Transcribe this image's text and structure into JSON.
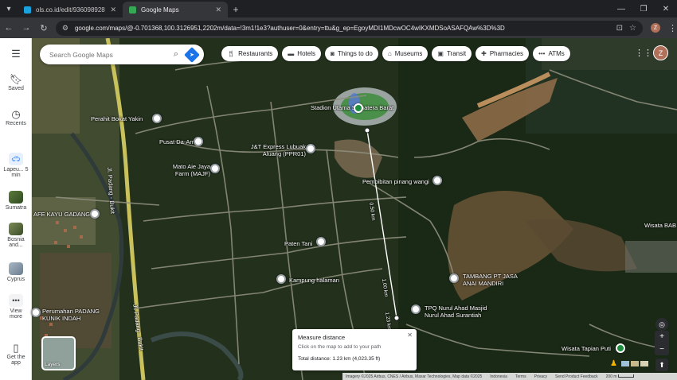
{
  "browser": {
    "tabs": [
      {
        "title": "ols.co.id/edit/936098928",
        "active": false,
        "favicon_color": "#18a3e0"
      },
      {
        "title": "Google Maps",
        "active": true,
        "favicon_color": "#34a853"
      }
    ],
    "url": "google.com/maps/@-0.701368,100.3126951,2202m/data=!3m1!1e3?authuser=0&entry=ttu&g_ep=EgoyMDI1MDcwOC4wIKXMDSoASAFQAw%3D%3D",
    "profile_initial": "Z"
  },
  "sidebar": {
    "items": [
      {
        "label": "Saved",
        "icon": "bookmark-icon"
      },
      {
        "label": "Recents",
        "icon": "history-icon"
      },
      {
        "label": "Lapeu... 5 min",
        "icon": "car-icon"
      },
      {
        "label": "Sumatra",
        "icon": "place-thumbnail"
      },
      {
        "label": "Bosnia and...",
        "icon": "place-thumbnail"
      },
      {
        "label": "Cyprus",
        "icon": "place-thumbnail"
      },
      {
        "label": "View more",
        "icon": "more-icon"
      },
      {
        "label": "Get the app",
        "icon": "phone-icon"
      }
    ]
  },
  "search": {
    "placeholder": "Search Google Maps"
  },
  "chips": [
    {
      "label": "Restaurants",
      "icon": "fork-knife-icon"
    },
    {
      "label": "Hotels",
      "icon": "bed-icon"
    },
    {
      "label": "Things to do",
      "icon": "camera-icon"
    },
    {
      "label": "Museums",
      "icon": "museum-icon"
    },
    {
      "label": "Transit",
      "icon": "bus-icon"
    },
    {
      "label": "Pharmacies",
      "icon": "pharmacy-icon"
    },
    {
      "label": "ATMs",
      "icon": "atm-icon"
    }
  ],
  "account_initial": "Z",
  "places": [
    {
      "name": "Stadion Utama Sumatera Barat",
      "kind": "green"
    },
    {
      "name": "Perahit Bokat Yakin",
      "kind": "white"
    },
    {
      "name": "Pusat Da-Am",
      "kind": "white"
    },
    {
      "name": "J&T Express Lubuak Aluang (PPR01)",
      "kind": "white"
    },
    {
      "name": "Mato Aie Jaya Farm (MAJF)",
      "kind": "white"
    },
    {
      "name": "Pembibitan pinang wangi",
      "kind": "white"
    },
    {
      "name": "AFE KAYU GADANG",
      "kind": "white"
    },
    {
      "name": "Paten Tani",
      "kind": "white"
    },
    {
      "name": "Kampung halaman",
      "kind": "white"
    },
    {
      "name": "TAMBANG PT JASA ANAI MANDIRI",
      "kind": "white"
    },
    {
      "name": "TPQ Nurul Ahad Masjid Nurul Ahad Surantiah",
      "kind": "white"
    },
    {
      "name": "Perumahan PADANG KUNIK INDAH",
      "kind": "white"
    },
    {
      "name": "Wisata Tapian Puti",
      "kind": "green"
    },
    {
      "name": "Wisata BAB",
      "kind": "none"
    }
  ],
  "road_labels": [
    "Jl. Padang - Bukit",
    "Jl. Padang - Bukit"
  ],
  "measure_labels": [
    "0.50 km",
    "1.00 km",
    "1.23 km"
  ],
  "measure": {
    "title": "Measure distance",
    "hint": "Click on the map to add to your path",
    "total": "Total distance: 1.23 km (4,023.35 ft)"
  },
  "layers_label": "Layers",
  "footer": {
    "imagery": "Imagery ©2025 Airbus, CNES / Airbus, Maxar Technologies, Map data ©2025",
    "country": "Indonesia",
    "terms": "Terms",
    "privacy": "Privacy",
    "feedback": "Send Product Feedback",
    "scale": "200 m"
  }
}
